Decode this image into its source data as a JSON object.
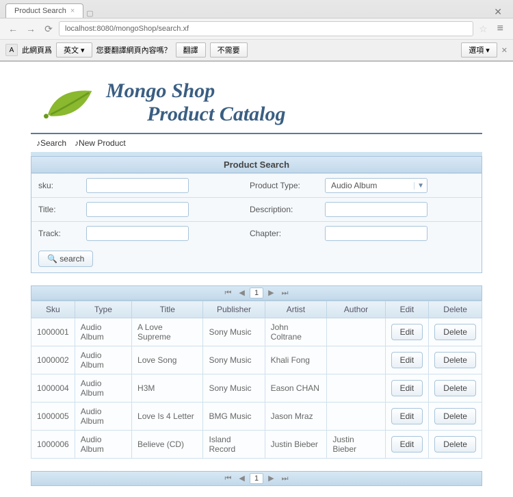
{
  "browser": {
    "tab_title": "Product Search",
    "url": "localhost:8080/mongoShop/search.xf",
    "translate": {
      "label_prefix": "此網頁爲",
      "lang": "英文",
      "label_suffix": "您要翻譯網頁內容嗎？",
      "btn_translate": "翻譯",
      "btn_no": "不需要",
      "options": "選項"
    }
  },
  "header": {
    "t1": "Mongo Shop",
    "t2": "Product Catalog"
  },
  "menu": {
    "search": "Search",
    "new_product": "New Product"
  },
  "panel": {
    "title": "Product Search"
  },
  "form": {
    "sku_label": "sku:",
    "title_label": "Title:",
    "track_label": "Track:",
    "ptype_label": "Product Type:",
    "desc_label": "Description:",
    "chapter_label": "Chapter:",
    "ptype_value": "Audio Album",
    "search_btn": "search"
  },
  "paginator": {
    "current": "1"
  },
  "table": {
    "headers": [
      "Sku",
      "Type",
      "Title",
      "Publisher",
      "Artist",
      "Author",
      "Edit",
      "Delete"
    ],
    "edit_label": "Edit",
    "delete_label": "Delete",
    "rows": [
      {
        "sku": "1000001",
        "type": "Audio Album",
        "title": "A Love Supreme",
        "publisher": "Sony Music",
        "artist": "John Coltrane",
        "author": ""
      },
      {
        "sku": "1000002",
        "type": "Audio Album",
        "title": "Love Song",
        "publisher": "Sony Music",
        "artist": "Khali Fong",
        "author": ""
      },
      {
        "sku": "1000004",
        "type": "Audio Album",
        "title": "H3M",
        "publisher": "Sony Music",
        "artist": "Eason CHAN",
        "author": ""
      },
      {
        "sku": "1000005",
        "type": "Audio Album",
        "title": "Love Is 4 Letter",
        "publisher": "BMG Music",
        "artist": "Jason Mraz",
        "author": ""
      },
      {
        "sku": "1000006",
        "type": "Audio Album",
        "title": "Believe (CD)",
        "publisher": "Island Record",
        "artist": "Justin Bieber",
        "author": "Justin Bieber"
      }
    ]
  }
}
